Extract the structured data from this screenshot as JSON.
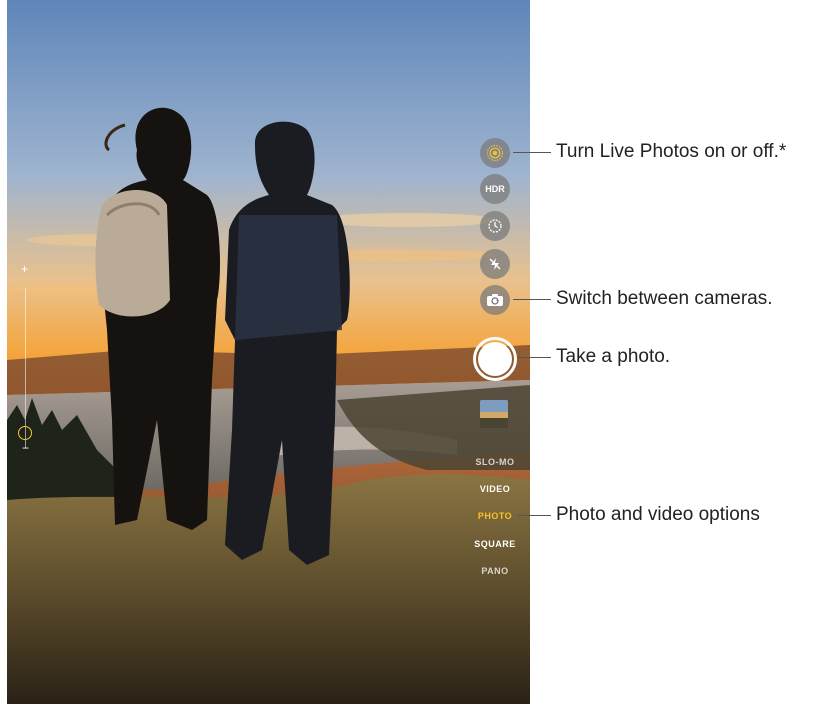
{
  "controls": {
    "hdr_label": "HDR"
  },
  "modes": [
    {
      "label": "SLO-MO",
      "active": false
    },
    {
      "label": "VIDEO",
      "active": false
    },
    {
      "label": "PHOTO",
      "active": true
    },
    {
      "label": "SQUARE",
      "active": false
    },
    {
      "label": "PANO",
      "active": false
    }
  ],
  "zoom": {
    "plus": "+",
    "minus": "−"
  },
  "callouts": {
    "live_photos": "Turn Live Photos on or off.*",
    "switch_cameras": "Switch between cameras.",
    "take_photo": "Take a photo.",
    "options": "Photo and video options"
  },
  "colors": {
    "accent": "#f6c12a"
  }
}
